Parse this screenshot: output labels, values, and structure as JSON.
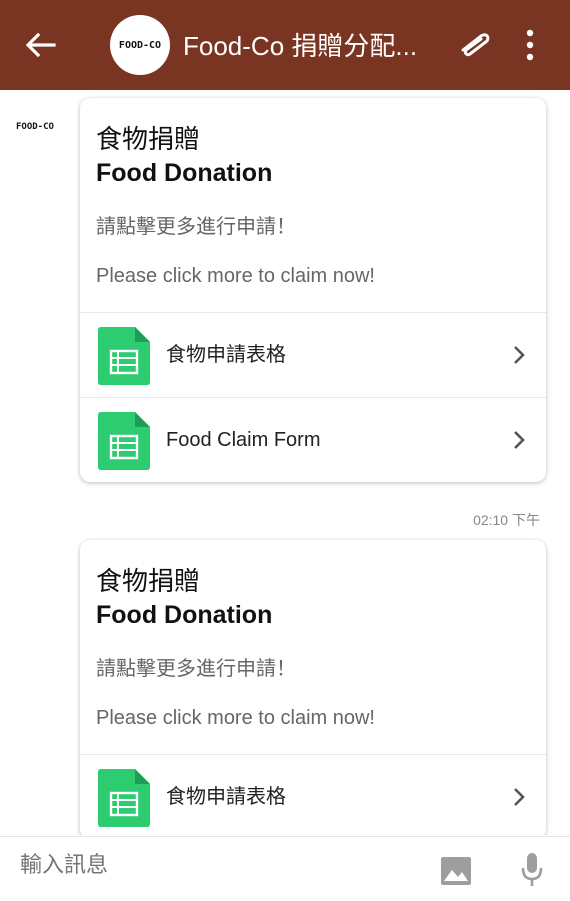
{
  "header": {
    "title": "Food-Co 捐贈分配...",
    "avatar_text": "FOOD-CO",
    "icons": [
      "back-arrow-icon",
      "attachment-icon",
      "more-vert-icon"
    ],
    "color": "#7a3422"
  },
  "chat": {
    "sender_logo_text": "FOOD-CO",
    "messages": [
      {
        "title_zh": "食物捐贈",
        "title_en": "Food Donation",
        "desc_zh": "請點擊更多進行申請！",
        "desc_en": "Please click more to claim now!",
        "links": [
          {
            "label": "食物申請表格",
            "icon": "sheet-doc-icon"
          },
          {
            "label": "Food Claim Form",
            "icon": "sheet-doc-icon"
          }
        ],
        "timestamp": "02:10 下午"
      },
      {
        "title_zh": "食物捐贈",
        "title_en": "Food Donation",
        "desc_zh": "請點擊更多進行申請！",
        "desc_en": "Please click more to claim now!",
        "links": [
          {
            "label": "食物申請表格",
            "icon": "sheet-doc-icon"
          }
        ]
      }
    ]
  },
  "composer": {
    "placeholder": "輸入訊息",
    "icons": [
      "image-icon",
      "mic-icon"
    ]
  },
  "colors": {
    "accent_green": "#2ecc71",
    "header_brown": "#7a3422"
  }
}
